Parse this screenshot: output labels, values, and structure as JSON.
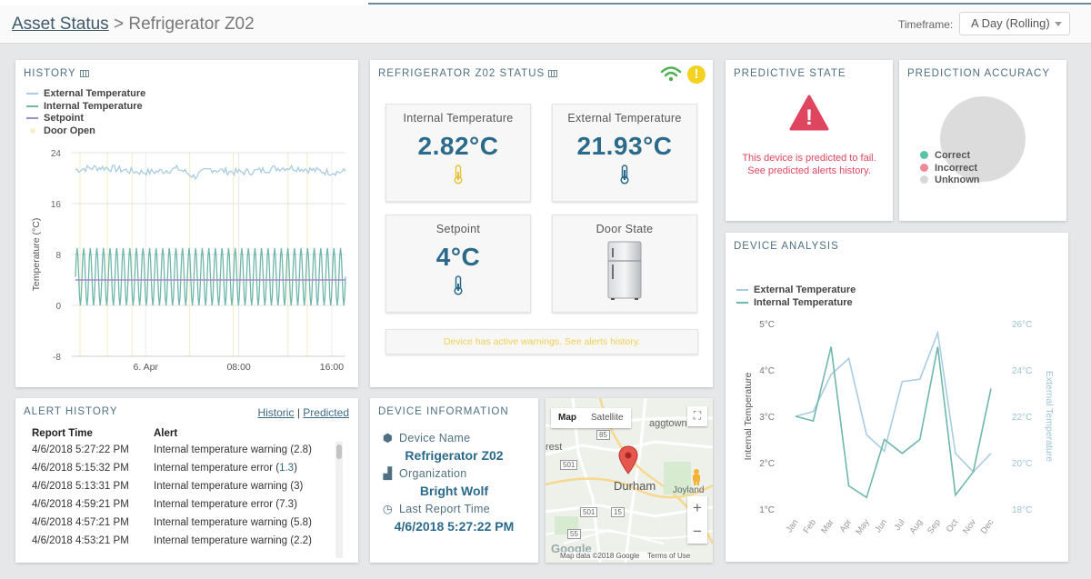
{
  "header": {
    "breadcrumb_root": "Asset Status",
    "breadcrumb_sep": ">",
    "breadcrumb_current": "Refrigerator Z02",
    "timeframe_label": "Timeframe:",
    "timeframe_value": "A Day (Rolling)"
  },
  "history": {
    "title": "HISTORY",
    "legend": [
      {
        "label": "External Temperature",
        "color": "#a9cde0"
      },
      {
        "label": "Internal Temperature",
        "color": "#6fb7ad"
      },
      {
        "label": "Setpoint",
        "color": "#a58cc3"
      },
      {
        "label": "Door Open",
        "color": "#f6efcc"
      }
    ]
  },
  "status": {
    "title": "REFRIGERATOR Z02 STATUS",
    "tiles": [
      {
        "label": "Internal Temperature",
        "value": "2.82°C"
      },
      {
        "label": "External Temperature",
        "value": "21.93°C"
      },
      {
        "label": "Setpoint",
        "value": "4°C"
      },
      {
        "label": "Door State",
        "value": ""
      }
    ],
    "warning_text": "Device has active warnings. See alerts history.",
    "warning_icon": "!",
    "colors": {
      "value": "#2b6a8a",
      "wifi": "#4caf50",
      "warn": "#f4d21f"
    }
  },
  "predictive": {
    "title": "PREDICTIVE STATE",
    "icon_text": "!",
    "message_line1": "This device is predicted to fail.",
    "message_line2": "See predicted alerts history.",
    "color": "#e0455f"
  },
  "accuracy": {
    "title": "PREDICTION ACCURACY",
    "legend": [
      {
        "label": "Correct",
        "color": "#5cc3a3"
      },
      {
        "label": "Incorrect",
        "color": "#ef8a95"
      },
      {
        "label": "Unknown",
        "color": "#d8d8d8"
      }
    ]
  },
  "analysis": {
    "title": "DEVICE ANALYSIS",
    "legend": [
      {
        "label": "External Temperature",
        "color": "#a9cde0"
      },
      {
        "label": "Internal Temperature",
        "color": "#6fb7ad"
      }
    ]
  },
  "alerts": {
    "title": "ALERT HISTORY",
    "link_historic": "Historic",
    "link_sep": "|",
    "link_predicted": "Predicted",
    "col_time": "Report Time",
    "col_alert": "Alert",
    "rows": [
      {
        "time": "4/6/2018 5:27:22 PM",
        "alert": "Internal temperature warning (",
        "val": "2.8",
        "end": ")"
      },
      {
        "time": "4/6/2018 5:15:32 PM",
        "alert": "Internal temperature error (",
        "val": "1.3",
        "end": ")"
      },
      {
        "time": "4/6/2018 5:13:31 PM",
        "alert": "Internal temperature warning (",
        "val": "3",
        "end": ")"
      },
      {
        "time": "4/6/2018 4:59:21 PM",
        "alert": "Internal temperature error (",
        "val": "7.3",
        "end": ")"
      },
      {
        "time": "4/6/2018 4:57:21 PM",
        "alert": "Internal temperature warning (",
        "val": "5.8",
        "end": ")"
      },
      {
        "time": "4/6/2018 4:53:21 PM",
        "alert": "Internal temperature warning (",
        "val": "2.2",
        "end": ")"
      }
    ]
  },
  "device_info": {
    "title": "DEVICE INFORMATION",
    "name_label": "Device Name",
    "name_value": "Refrigerator Z02",
    "org_label": "Organization",
    "org_value": "Bright Wolf",
    "report_label": "Last Report Time",
    "report_value": "4/6/2018 5:27:22 PM"
  },
  "map": {
    "tab_map": "Map",
    "tab_satellite": "Satellite",
    "city": "Durham",
    "places": [
      "aggtown",
      "rest",
      "Joyland"
    ],
    "roads": [
      "501",
      "85",
      "15",
      "15",
      "501",
      "55"
    ],
    "footer_data": "Map data ©2018 Google",
    "footer_terms": "Terms of Use",
    "google": "Google",
    "zoom_in": "+",
    "zoom_out": "−",
    "fullscreen": "⛶"
  },
  "chart_data": [
    {
      "type": "line",
      "title": "HISTORY",
      "xlabel": "",
      "ylabel": "Temperature (°C)",
      "ylim": [
        -8,
        24
      ],
      "yticks": [
        -8,
        0,
        8,
        16,
        24
      ],
      "xticks": [
        "6. Apr",
        "08:00",
        "16:00"
      ],
      "grid": true,
      "legend_position": "top-left",
      "series": [
        {
          "name": "External Temperature",
          "pattern": "noisy",
          "base": 21.3,
          "amplitude": 0.8,
          "dip": 19.5
        },
        {
          "name": "Internal Temperature",
          "pattern": "oscillating",
          "min": 0,
          "max": 9,
          "cycles": 41
        },
        {
          "name": "Setpoint",
          "pattern": "constant",
          "value": 4
        },
        {
          "name": "Door Open",
          "pattern": "events"
        }
      ]
    },
    {
      "type": "line",
      "title": "DEVICE ANALYSIS",
      "categories": [
        "Jan",
        "Feb",
        "Mar",
        "Apr",
        "May",
        "Jun",
        "Jul",
        "Aug",
        "Sep",
        "Oct",
        "Nov",
        "Dec"
      ],
      "ylabel": "Internal Temperature",
      "ylabel_right": "External Temperature",
      "ylim": [
        1,
        5
      ],
      "ylim_right": [
        18,
        26
      ],
      "yticks_left": [
        "1°C",
        "2°C",
        "3°C",
        "4°C",
        "5°C"
      ],
      "yticks_right": [
        "18°C",
        "20°C",
        "22°C",
        "24°C",
        "26°C"
      ],
      "legend_position": "top-left",
      "series": [
        {
          "name": "External Temperature",
          "axis": "right",
          "values": [
            22.0,
            22.2,
            23.8,
            24.5,
            21.2,
            20.5,
            23.5,
            23.6,
            25.6,
            20.4,
            19.6,
            20.4
          ]
        },
        {
          "name": "Internal Temperature",
          "axis": "left",
          "values": [
            3.0,
            2.9,
            4.5,
            1.5,
            1.25,
            2.5,
            2.2,
            2.5,
            4.5,
            1.3,
            1.8,
            3.6
          ]
        }
      ]
    }
  ]
}
